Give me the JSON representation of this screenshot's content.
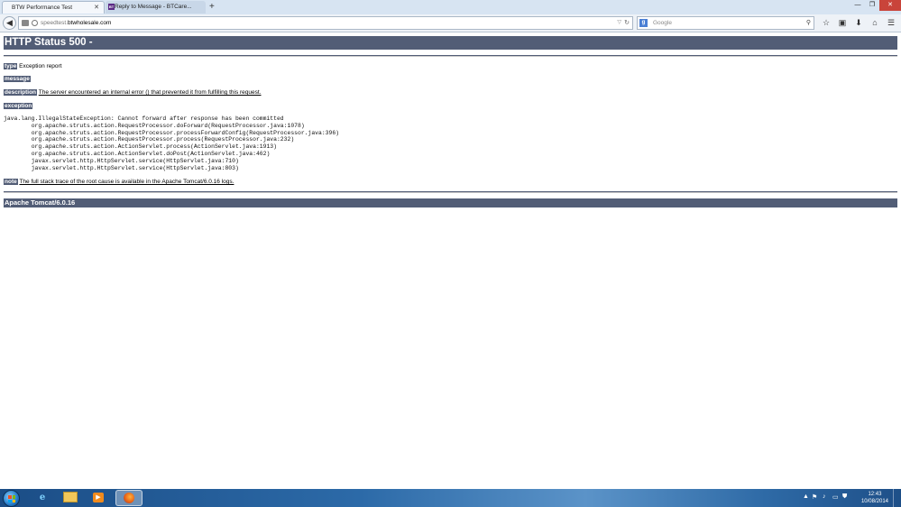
{
  "browser": {
    "tabs": [
      {
        "title": "BTW Performance Test",
        "active": true
      },
      {
        "title": "Reply to Message - BTCare...",
        "active": false
      }
    ],
    "url_subdomain": "speedtest.",
    "url_host": "btwholesale.com",
    "search_placeholder": "Google"
  },
  "page": {
    "heading": "HTTP Status 500 -",
    "type_label": "type",
    "type_value": " Exception report",
    "message_label": "message",
    "description_label": "description",
    "description_value": "The server encountered an internal error () that prevented it from fulfilling this request.",
    "exception_label": "exception",
    "stack_trace": "java.lang.IllegalStateException: Cannot forward after response has been committed\n\torg.apache.struts.action.RequestProcessor.doForward(RequestProcessor.java:1078)\n\torg.apache.struts.action.RequestProcessor.processForwardConfig(RequestProcessor.java:396)\n\torg.apache.struts.action.RequestProcessor.process(RequestProcessor.java:232)\n\torg.apache.struts.action.ActionServlet.process(ActionServlet.java:1913)\n\torg.apache.struts.action.ActionServlet.doPost(ActionServlet.java:462)\n\tjavax.servlet.http.HttpServlet.service(HttpServlet.java:710)\n\tjavax.servlet.http.HttpServlet.service(HttpServlet.java:803)",
    "note_label": "note",
    "note_value": "The full stack trace of the root cause is available in the Apache Tomcat/6.0.16 logs.",
    "footer": "Apache Tomcat/6.0.16"
  },
  "taskbar": {
    "icons": [
      "start-orb",
      "internet-explorer-icon",
      "file-explorer-icon",
      "media-player-icon",
      "firefox-icon"
    ],
    "clock_time": "12:43",
    "clock_date": "10/08/2014"
  },
  "colors": {
    "tomcat_header": "#525d76",
    "taskbar": "#2c6aa8"
  }
}
